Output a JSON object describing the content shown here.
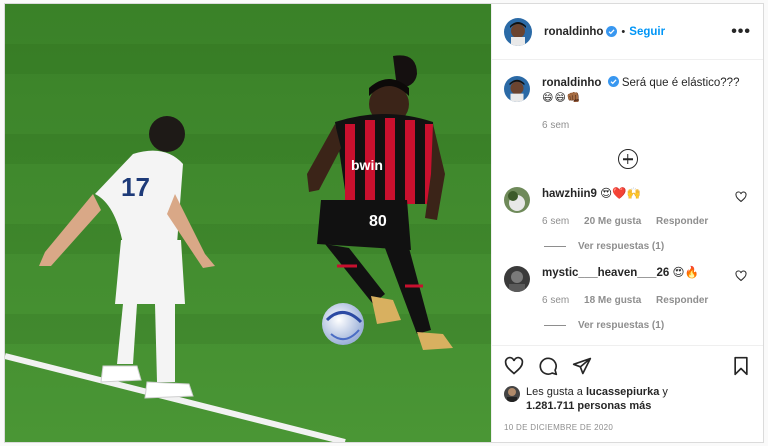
{
  "header": {
    "username": "ronaldinho",
    "separator": "•",
    "follow_label": "Seguir",
    "more_label": "•••"
  },
  "caption": {
    "username": "ronaldinho",
    "text": "Será que é elástico???",
    "emojis": "😄😄👊🏾",
    "time": "6 sem"
  },
  "comments": [
    {
      "username": "hawzhiin9",
      "emojis": "😍❤️🙌",
      "time": "6 sem",
      "likes": "20 Me gusta",
      "reply": "Responder",
      "view_replies": "Ver respuestas (1)"
    },
    {
      "username": "mystic___heaven___26",
      "emojis": "😍🔥",
      "time": "6 sem",
      "likes": "18 Me gusta",
      "reply": "Responder",
      "view_replies": "Ver respuestas (1)"
    }
  ],
  "likes": {
    "prefix": "Les gusta a ",
    "user": "lucassepiurka",
    "connector": " y",
    "count": "1.281.711 personas más"
  },
  "date": "10 DE DICIEMBRE DE 2020",
  "photo": {
    "jersey_text": "bwin",
    "player_number": "80",
    "opponent_number": "17"
  },
  "colors": {
    "accent": "#0095f6",
    "pitch": "#3f8a2c",
    "milan_red": "#c8102e"
  }
}
